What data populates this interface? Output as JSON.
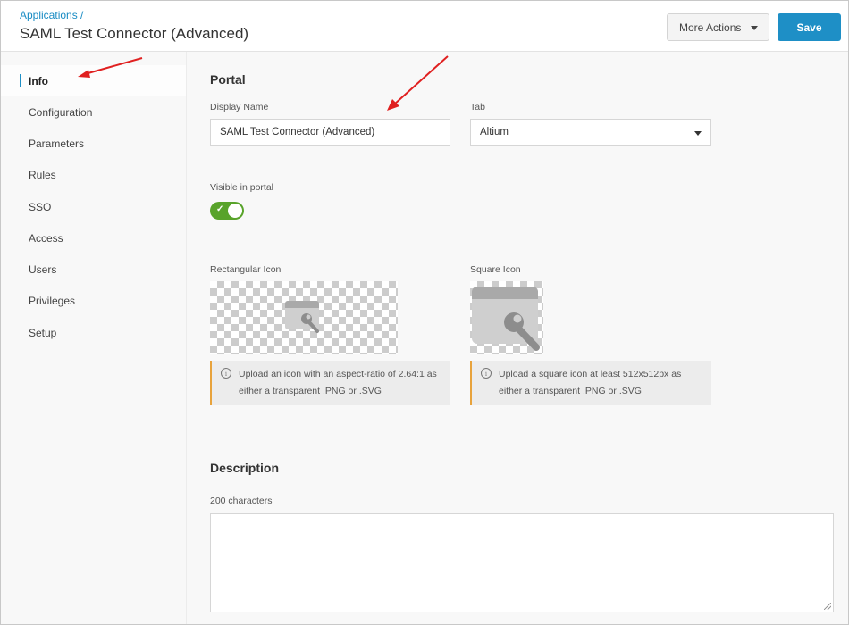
{
  "header": {
    "breadcrumb": "Applications /",
    "title": "SAML Test Connector (Advanced)",
    "more_actions_label": "More Actions",
    "save_label": "Save"
  },
  "sidebar": {
    "items": [
      {
        "label": "Info",
        "active": true
      },
      {
        "label": "Configuration"
      },
      {
        "label": "Parameters"
      },
      {
        "label": "Rules"
      },
      {
        "label": "SSO"
      },
      {
        "label": "Access"
      },
      {
        "label": "Users"
      },
      {
        "label": "Privileges"
      },
      {
        "label": "Setup"
      }
    ]
  },
  "portal": {
    "section_title": "Portal",
    "display_name_label": "Display Name",
    "display_name_value": "SAML Test Connector (Advanced)",
    "tab_label": "Tab",
    "tab_value": "Altium",
    "visible_label": "Visible in portal",
    "visible_value": true,
    "toggle_check": "✓",
    "rect_icon_label": "Rectangular Icon",
    "square_icon_label": "Square Icon",
    "rect_info_line1": "Upload an icon with an aspect-ratio of 2.64:1 as",
    "rect_info_line2": "either a transparent .PNG or .SVG",
    "square_info_line1": "Upload a square icon at least 512x512px as",
    "square_info_line2": "either a transparent .PNG or .SVG",
    "info_glyph": "i"
  },
  "description": {
    "section_title": "Description",
    "limit_label": "200 characters",
    "value": ""
  },
  "colors": {
    "accent": "#1e8fc6",
    "toggle_on": "#58a32a",
    "info_border": "#e8a33c",
    "annotation_arrow": "#e02020"
  }
}
